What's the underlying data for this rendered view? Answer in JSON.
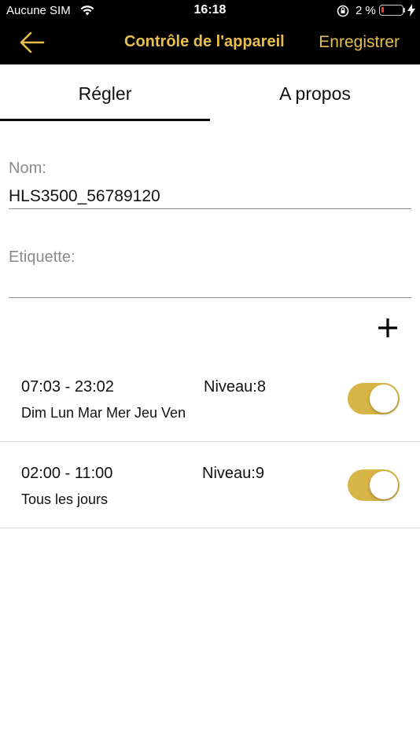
{
  "status_bar": {
    "carrier": "Aucune SIM",
    "time": "16:18",
    "battery_percent": "2 %"
  },
  "navbar": {
    "back_icon": "arrow-left-icon",
    "title": "Contrôle de l'appareil",
    "save_label": "Enregistrer",
    "accent_color": "#e6bf4c"
  },
  "tabs": [
    {
      "label": "Régler",
      "selected": true
    },
    {
      "label": "A propos",
      "selected": false
    }
  ],
  "form": {
    "name_label": "Nom:",
    "name_value": "HLS3500_56789120",
    "tag_label": "Etiquette:",
    "tag_value": ""
  },
  "add_icon": "plus-icon",
  "schedules": [
    {
      "range": "07:03 - 23:02",
      "level": "Niveau:8",
      "days": "Dim Lun Mar Mer Jeu Ven",
      "enabled": true
    },
    {
      "range": "02:00 - 11:00",
      "level": "Niveau:9",
      "days": "Tous les jours",
      "enabled": true
    }
  ],
  "toggle_color": "#d8b547"
}
